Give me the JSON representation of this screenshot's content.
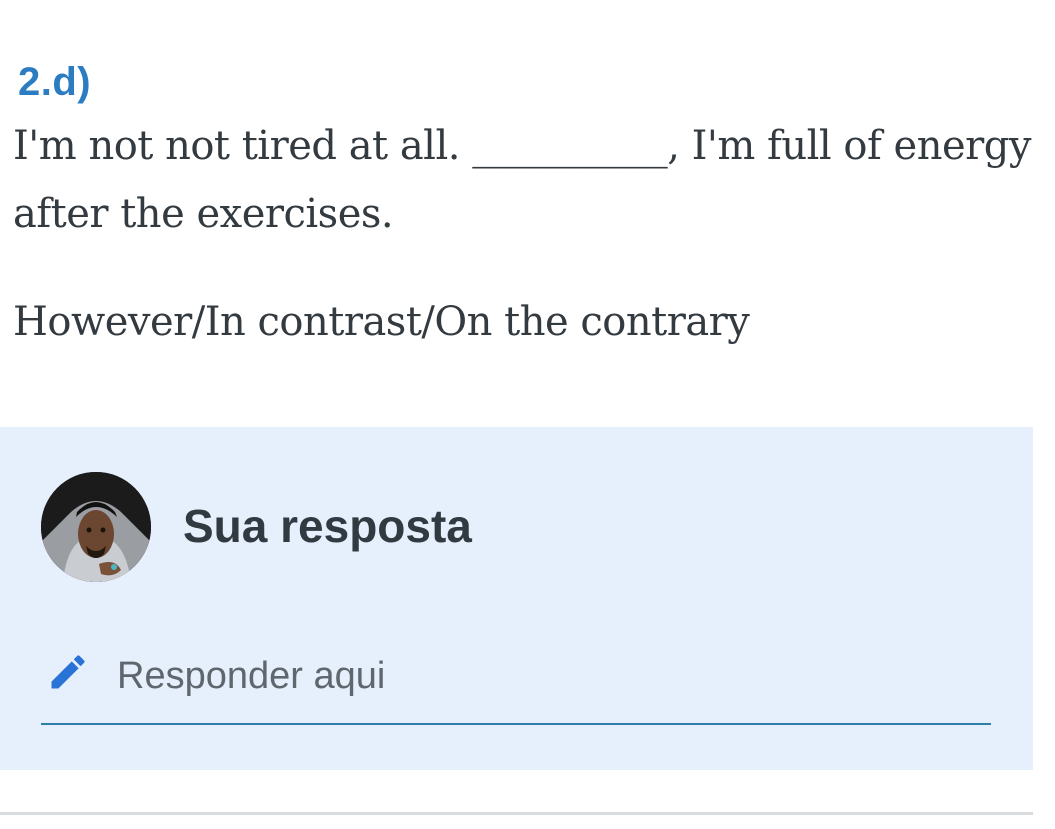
{
  "question": {
    "label": "2.d)",
    "text_before_blank": "I'm not not tired at all. ",
    "blank": "__________",
    "text_after_blank": ", I'm full of energy after the exercises.",
    "options": "However/In contrast/On the contrary"
  },
  "answer_panel": {
    "title": "Sua resposta",
    "avatar_icon": "user-avatar",
    "pencil_icon": "pencil-icon",
    "input_placeholder": "Responder aqui",
    "input_value": "",
    "colors": {
      "panel_background": "#e6f0fd",
      "accent": "#2b7cc0",
      "underline": "#2e7ea8"
    }
  }
}
